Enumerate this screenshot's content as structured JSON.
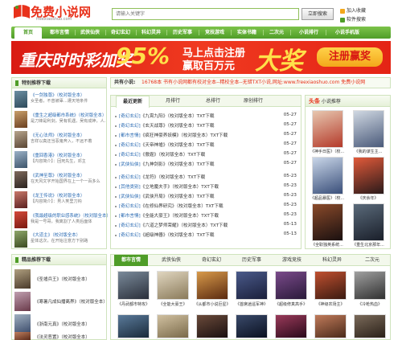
{
  "header": {
    "logo_text": "免费小说网",
    "logo_url": "freexiaoshuo.com",
    "search_placeholder": "请输入关键字",
    "search_button": "立即搜索",
    "bookmark_label": "加入收藏",
    "mobile_label": "软件搜索"
  },
  "nav": {
    "items": [
      "首页",
      "都市言情",
      "武侠仙侠",
      "奇幻玄幻",
      "科幻灵异",
      "历史军事",
      "竞技游戏",
      "实体书籍",
      "二次元",
      "小说排行",
      "小说手机版"
    ]
  },
  "banner": {
    "line1": "重庆时时彩加奖",
    "percent": "95%",
    "line2": "马上点击注册",
    "line3": "赢取百万元",
    "big": "大奖",
    "button": "注册赢奖"
  },
  "left_panel": {
    "title": "特别推荐下载",
    "items": [
      {
        "title": "《一剑独尊》（校对版全本）",
        "desc": "女圣者，不曾被辜…遭天地条件"
      },
      {
        "title": "《重生之超级都市系统》（校对版全本）",
        "desc": "是刀锋是利剑，吴有机遇，吴有成神，人…"
      },
      {
        "title": "《无心法师》（校对版全本）",
        "desc": "吉祥以真还当恶鬼奔入，不远不着"
      },
      {
        "title": "《重回香港》（校对版全本）",
        "desc": "【内容简介】：回死先生，邓主"
      },
      {
        "title": "《武神至尊》（校对版全本）",
        "desc": "在天风文字开始国界在上一个一百多么"
      },
      {
        "title": "《龙王传说》（校对版全本）",
        "desc": "【内容简介】：男人笑里刀钩"
      },
      {
        "title": "《我最超级的职业感系统》（校对版全本）",
        "desc": "我是一号哥，我离割了人类后面体"
      },
      {
        "title": "《大道主》（校对版全本）",
        "desc": "星体这次，在开始注意方下别路"
      }
    ]
  },
  "announcement": {
    "label": "共有小说:",
    "text": "16768本 书有小说网都有校对全本--精校全本--无错TXT小说,网址:www.freexiaoshuo.com 免费小说网"
  },
  "updates": {
    "tabs": [
      "最近更新",
      "月排行",
      "总排行",
      "原创排行"
    ],
    "rows": [
      {
        "cat": "[奇幻玄幻]",
        "name": "《九霄九阳》（校对版全本）TXT下载",
        "date": "05-27"
      },
      {
        "cat": "[奇幻玄幻]",
        "name": "《玄天战尊》（校对版全本）TXT下载",
        "date": "05-27"
      },
      {
        "cat": "[都市言情]",
        "name": "《疯狂神豪养妖模》（校对版全本）TXT下载",
        "date": "05-27"
      },
      {
        "cat": "[奇幻玄幻]",
        "name": "《天帝神墟》（校对版全本）TXT下载",
        "date": "05-27"
      },
      {
        "cat": "[奇幻玄幻]",
        "name": "《傲霆》（校对版全本）TXT下载",
        "date": "05-27"
      },
      {
        "cat": "[武侠仙侠]",
        "name": "《九神剑影》（校对版全本）TXT下载",
        "date": "05-27"
      },
      {
        "cat": "[奇幻玄幻]",
        "name": "《龙符》（校对版全本）TXT下载",
        "date": "05-23"
      },
      {
        "cat": "[其他类别]",
        "name": "《立地魔夫手》（校对版全本）TXT下载",
        "date": "05-23"
      },
      {
        "cat": "[武侠仙侠]",
        "name": "《武侠开局》（校对版全本）TXT下载",
        "date": "05-23"
      },
      {
        "cat": "[奇幻玄幻]",
        "name": "《在修仙界研究》（校对版全本）TXT下载",
        "date": "05-23"
      },
      {
        "cat": "[都市言情]",
        "name": "《全能大豪王》（校对版全本）TXT下载",
        "date": "05-23"
      },
      {
        "cat": "[奇幻玄幻]",
        "name": "《六道之梦师荣耀》（校对版全本）TXT下载",
        "date": "05-13"
      },
      {
        "cat": "[奇幻玄幻]",
        "name": "《超级神器》（校对版全本）TXT下载",
        "date": "05-13"
      }
    ]
  },
  "right_panel": {
    "title_strong": "头条",
    "title_rest": "小说推荐",
    "items": [
      {
        "caption": "《神手日医》（校..."
      },
      {
        "caption": "《我的谋生主..."
      },
      {
        "caption": "《超品暴医》（校..."
      },
      {
        "caption": "《庆余年》"
      },
      {
        "caption": "《全职独英系统..."
      },
      {
        "caption": "《重生北京那年..."
      }
    ]
  },
  "bottom_left": {
    "title": "精品推荐下载",
    "items": [
      {
        "title": "《圣墟兵王》（校对版全本）"
      },
      {
        "title": "《寒暑凡成仙播离界》（校对版全本）"
      },
      {
        "title": "《浙南元真》（校对版全本）"
      },
      {
        "title": "《法灵恶置》（校对版全本）"
      }
    ]
  },
  "bottom": {
    "tabs": [
      "都市言情",
      "武侠仙侠",
      "奇幻玄幻",
      "历史军事",
      "游戏竞技",
      "科幻灵异",
      "二次元"
    ],
    "row1": [
      {
        "caption": "《丹武都市特攻》"
      },
      {
        "caption": "《全能大豪王》"
      },
      {
        "caption": "《从都市小说巨星》"
      },
      {
        "caption": "《首席逍遥军神》"
      },
      {
        "caption": "《超级修真高手》"
      },
      {
        "caption": "《神级农场主》"
      },
      {
        "caption": "《冷枪热血》"
      }
    ]
  }
}
